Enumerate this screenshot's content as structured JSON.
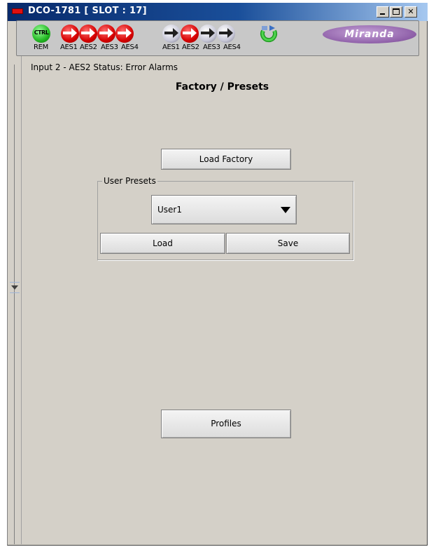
{
  "window": {
    "title": "DCO-1781 [ SLOT : 17]"
  },
  "status_bar": {
    "ctrl_label": "CTRL",
    "rem_label": "REM",
    "inputs_group_1": [
      "AES1",
      "AES2",
      "AES3",
      "AES4"
    ],
    "inputs_group_2": [
      "AES1",
      "AES2",
      "AES3",
      "AES4"
    ],
    "brand": "Miranda",
    "colors": {
      "error": "#d60000",
      "ok": "#22b822",
      "idle": "#c8c8d8"
    }
  },
  "status_message": "Input 2 - AES2 Status: Error Alarms",
  "page": {
    "title": "Factory / Presets",
    "load_factory_label": "Load Factory",
    "user_presets": {
      "group_label": "User Presets",
      "selected": "User1",
      "load_label": "Load",
      "save_label": "Save"
    },
    "profiles_label": "Profiles"
  },
  "icons": [
    "app-icon",
    "minimize-icon",
    "maximize-icon",
    "close-icon",
    "input-arrow-icon",
    "refresh-icon",
    "dropdown-arrow-icon",
    "collapse-arrow-icon"
  ]
}
